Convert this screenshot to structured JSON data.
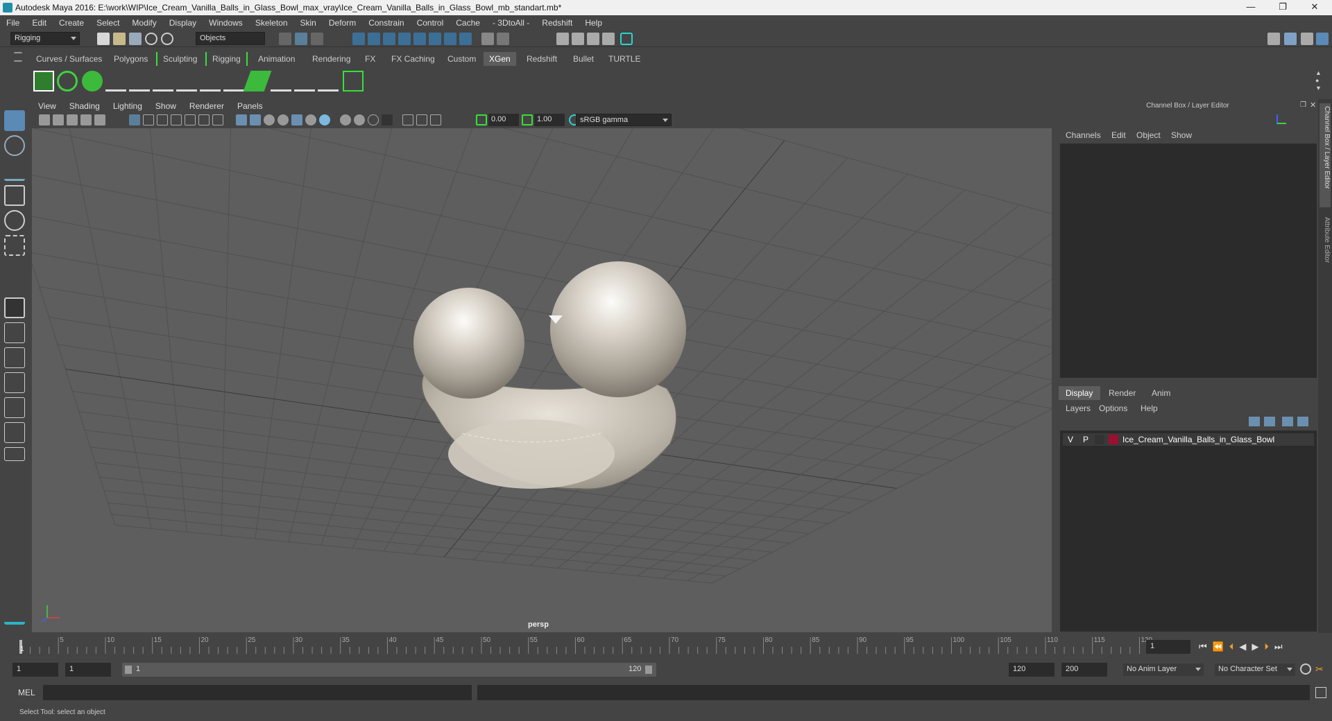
{
  "window": {
    "title": "Autodesk Maya 2016: E:\\work\\WIP\\Ice_Cream_Vanilla_Balls_in_Glass_Bowl_max_vray\\Ice_Cream_Vanilla_Balls_in_Glass_Bowl_mb_standart.mb*",
    "minimize": "—",
    "restore": "❐",
    "close": "✕"
  },
  "menubar": [
    "File",
    "Edit",
    "Create",
    "Select",
    "Modify",
    "Display",
    "Windows",
    "Skeleton",
    "Skin",
    "Deform",
    "Constrain",
    "Control",
    "Cache",
    "- 3DtoAll -",
    "Redshift",
    "Help"
  ],
  "statusline": {
    "mode": "Rigging",
    "selection_mask": "Objects"
  },
  "shelf_tabs": [
    "Curves / Surfaces",
    "Polygons",
    "Sculpting",
    "Rigging",
    "Animation",
    "Rendering",
    "FX",
    "FX Caching",
    "Custom",
    "XGen",
    "Redshift",
    "Bullet",
    "TURTLE"
  ],
  "shelf_active_tab": "XGen",
  "viewport": {
    "menu": [
      "View",
      "Shading",
      "Lighting",
      "Show",
      "Renderer",
      "Panels"
    ],
    "exposure": "0.00",
    "gamma": "1.00",
    "color_space": "sRGB gamma",
    "camera_label": "persp"
  },
  "channel_box": {
    "title": "Channel Box / Layer Editor",
    "menu": [
      "Channels",
      "Edit",
      "Object",
      "Show"
    ]
  },
  "layer_editor": {
    "tabs": [
      "Display",
      "Render",
      "Anim"
    ],
    "active_tab": "Display",
    "menu": [
      "Layers",
      "Options",
      "Help"
    ],
    "layers": [
      {
        "v": "V",
        "p": "P",
        "color": "#9a1030",
        "name": "Ice_Cream_Vanilla_Balls_in_Glass_Bowl"
      }
    ]
  },
  "side_tabs": [
    "Channel Box / Layer Editor",
    "Attribute Editor"
  ],
  "timeline": {
    "ticks": [
      "5",
      "10",
      "15",
      "20",
      "25",
      "30",
      "35",
      "40",
      "45",
      "50",
      "55",
      "60",
      "65",
      "70",
      "75",
      "80",
      "85",
      "90",
      "95",
      "100",
      "105",
      "110",
      "115",
      "120"
    ],
    "start_label": "1",
    "current_frame": "1"
  },
  "range": {
    "start": "1",
    "playback_start": "1",
    "slider_start": "1",
    "slider_end": "120",
    "playback_end": "120",
    "end": "200",
    "anim_layer": "No Anim Layer",
    "character_set": "No Character Set"
  },
  "command_line": {
    "label": "MEL"
  },
  "help_line": "Select Tool: select an object"
}
